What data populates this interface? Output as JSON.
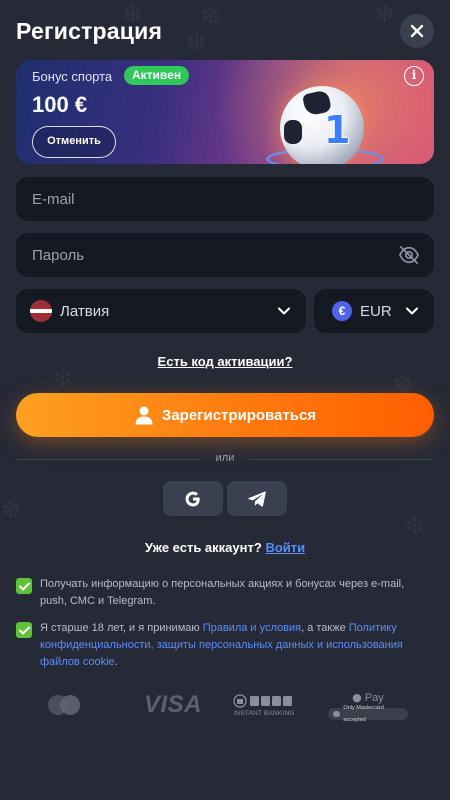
{
  "header": {
    "title": "Регистрация"
  },
  "bonus": {
    "label": "Бонус спорта",
    "status": "Активен",
    "amount": "100 €",
    "cancel_label": "Отменить",
    "ball_number": "1"
  },
  "form": {
    "email_placeholder": "E-mail",
    "password_placeholder": "Пароль",
    "country": "Латвия",
    "currency": "EUR",
    "currency_symbol": "€"
  },
  "activation_link": "Есть код активации?",
  "register_label": "Зарегистрироваться",
  "divider_text": "или",
  "login": {
    "prompt": "Уже есть аккаунт?",
    "link": "Войти"
  },
  "consents": {
    "marketing": "Получать информацию о персональных акциях и бонусах через e-mail, push, СМС и Telegram.",
    "terms_prefix": "Я старше 18 лет, и я принимаю",
    "terms_link": "Правила и условия",
    "terms_mid": ", а также",
    "privacy_link": "Политику конфиденциальности, защиты персональных данных и использования файлов cookie",
    "terms_suffix": "."
  },
  "payments": {
    "visa": "VISA",
    "instant_banking": "INSTANT BANKING",
    "apple_pay": "Pay",
    "apple_note": "Only Mastercard accepted"
  },
  "colors": {
    "background": "#252a36",
    "field": "#151922",
    "accent_orange": "#ff7a0e",
    "link_blue": "#5a8dff",
    "active_green": "#30c85a",
    "checkbox_green": "#5fc238"
  }
}
